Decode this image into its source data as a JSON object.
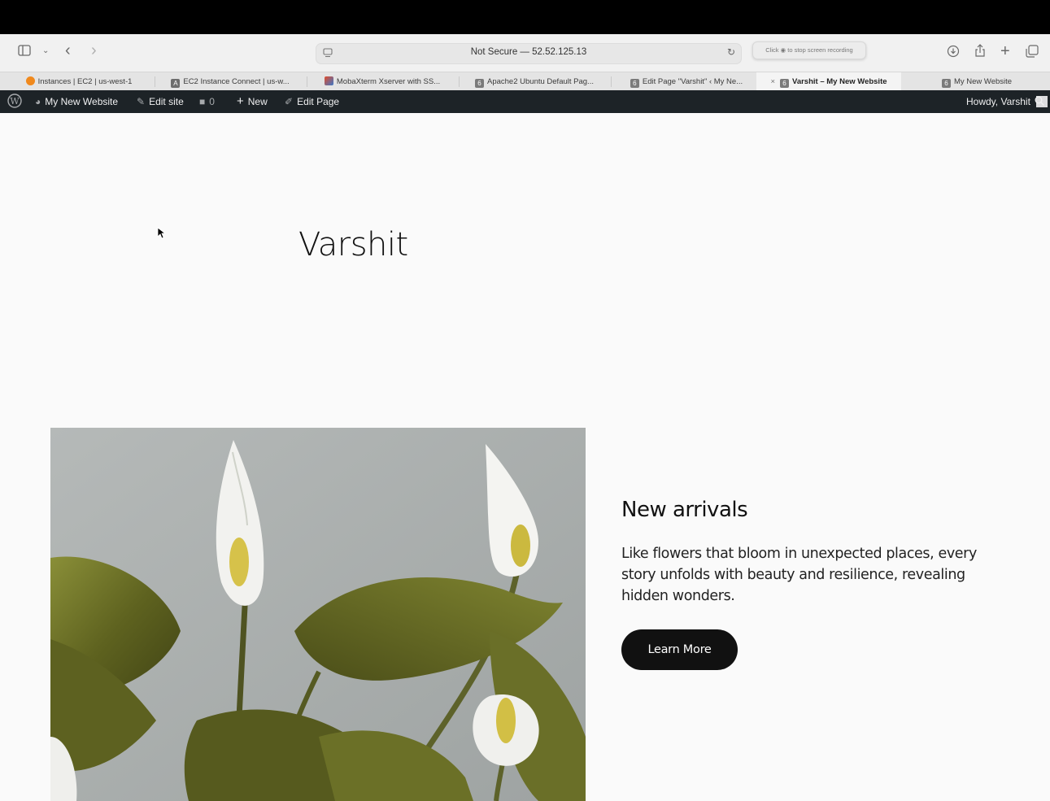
{
  "browser": {
    "address_text": "Not Secure — 52.52.125.13",
    "recording_notice": "Click ◉ to stop screen recording",
    "icons": [
      "sidebar-icon",
      "chevron-down-icon",
      "back-icon",
      "forward-icon",
      "privacy-icon",
      "reload-icon",
      "download-icon",
      "share-icon",
      "new-tab-icon",
      "tab-overview-icon"
    ]
  },
  "tabs": [
    {
      "label": "Instances | EC2 | us-west-1",
      "favicon_color": "#f0891d",
      "favicon_glyph": ""
    },
    {
      "label": "EC2 Instance Connect | us-w...",
      "favicon_color": "#6d6d6d",
      "favicon_glyph": "A"
    },
    {
      "label": "MobaXterm Xserver with SS...",
      "favicon_color": "#e24b2a",
      "favicon_glyph": ""
    },
    {
      "label": "Apache2 Ubuntu Default Pag...",
      "favicon_color": "#7a7a7a",
      "favicon_glyph": "6"
    },
    {
      "label": "Edit Page \"Varshit\" ‹ My Ne...",
      "favicon_color": "#7a7a7a",
      "favicon_glyph": "6"
    },
    {
      "label": "Varshit – My New Website",
      "favicon_color": "#7a7a7a",
      "favicon_glyph": "6",
      "active": true,
      "close": "×"
    },
    {
      "label": "My New Website",
      "favicon_color": "#7a7a7a",
      "favicon_glyph": "6"
    }
  ],
  "adminbar": {
    "site_name": "My New Website",
    "edit_site": "Edit site",
    "comments_count": "0",
    "new_label": "New",
    "edit_page": "Edit Page",
    "howdy": "Howdy, Varshit"
  },
  "page": {
    "site_title": "Varshit",
    "section_title": "New arrivals",
    "section_text": "Like flowers that bloom in unexpected places, every story unfolds with beauty and resilience, revealing hidden wonders.",
    "cta_label": "Learn More"
  },
  "colors": {
    "adminbar_bg": "#1d2327",
    "button_bg": "#111111",
    "page_bg": "#fafafa"
  }
}
